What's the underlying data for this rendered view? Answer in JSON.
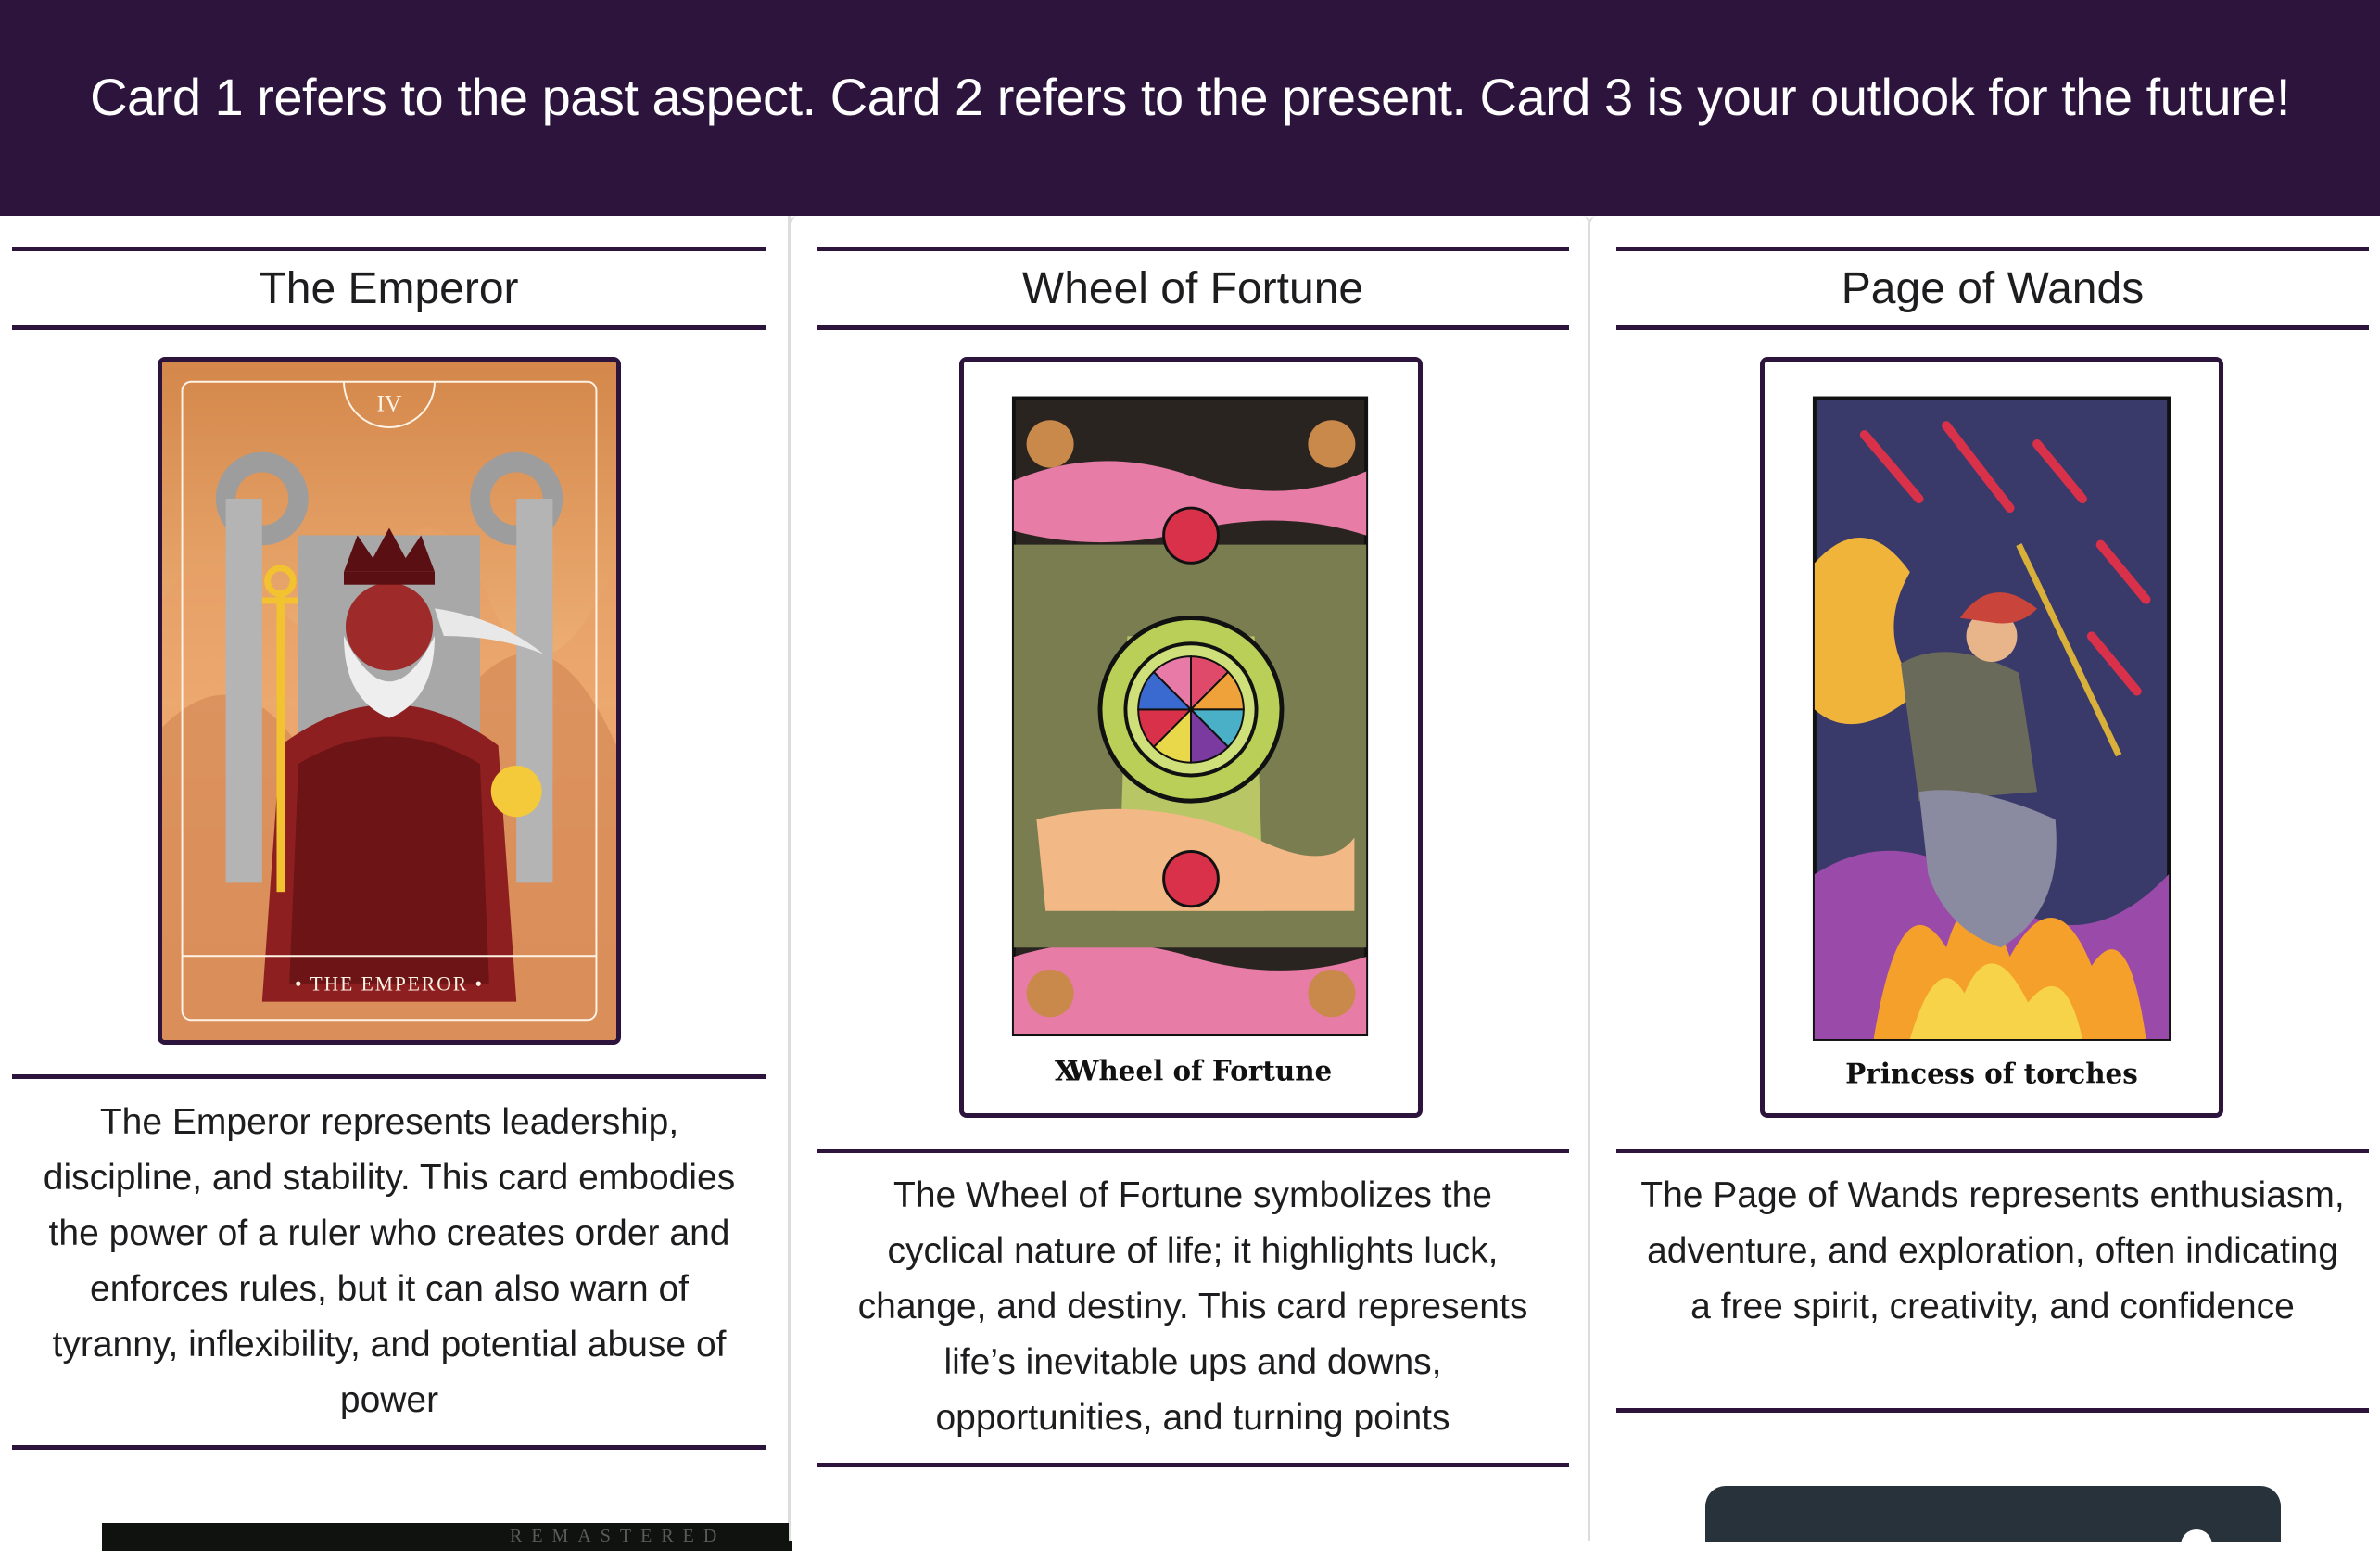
{
  "banner": {
    "text": "Card 1 refers to the past aspect. Card 2 refers to the present. Card 3 is your outlook for the future!"
  },
  "cards": [
    {
      "title": "The Emperor",
      "image_numeral": "IV",
      "image_caption": "• THE EMPEROR •",
      "description": "The Emperor represents leadership, discipline, and stability. This card embodies the power of a ruler who creates order and enforces rules, but it can also warn of tyranny, inflexibility, and potential abuse of power"
    },
    {
      "title": "Wheel of Fortune",
      "image_numeral": "X",
      "image_caption": "Wheel of Fortune",
      "description": "The Wheel of Fortune symbolizes the cyclical nature of life; it highlights luck, change, and destiny. This card represents life’s inevitable ups and downs, opportunities, and turning points"
    },
    {
      "title": "Page of Wands",
      "image_caption": "Princess of torches",
      "description": "The Page of Wands represents enthusiasm, adventure, and exploration, often indicating a free spirit, creativity, and confidence"
    }
  ],
  "peek": {
    "label": "REMASTERED"
  },
  "colors": {
    "banner_bg": "#2d143c",
    "accent_rule": "#2d143c",
    "text": "#1d1d1f"
  }
}
